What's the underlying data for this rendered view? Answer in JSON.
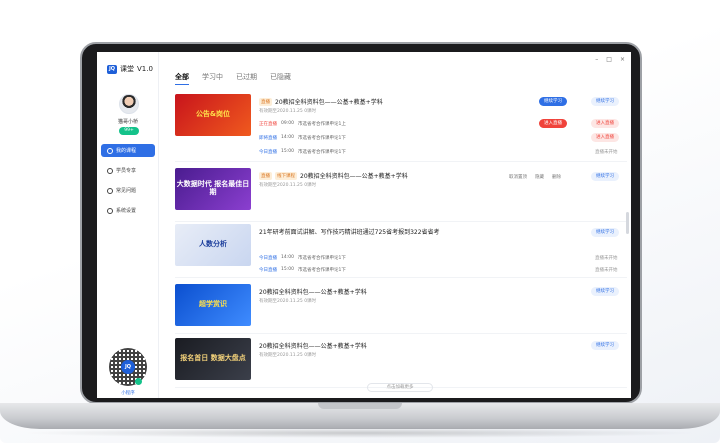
{
  "app": {
    "logo_mark": "JQ",
    "name": "课堂",
    "version": "V1.0"
  },
  "window_controls": {
    "minimize": "–",
    "maximize": "□",
    "close": "×"
  },
  "user": {
    "name": "猫哥小桥",
    "vip": "99+"
  },
  "sidebar": {
    "items": [
      {
        "label": "我的课程",
        "icon": "book-icon",
        "active": true
      },
      {
        "label": "学员专享",
        "icon": "gift-icon",
        "active": false
      },
      {
        "label": "常见问题",
        "icon": "question-icon",
        "active": false
      },
      {
        "label": "系统设置",
        "icon": "gear-icon",
        "active": false
      }
    ],
    "miniapp_label": "小程序"
  },
  "tabs": [
    {
      "label": "全部",
      "active": true
    },
    {
      "label": "学习中",
      "active": false
    },
    {
      "label": "已过期",
      "active": false
    },
    {
      "label": "已隐藏",
      "active": false
    }
  ],
  "courses": [
    {
      "thumb_text": "公告&岗位",
      "tags": [
        "直播"
      ],
      "title": "20教招全科资料包——公基+教基+学科",
      "meta": "有效期至2020.11.25   0课时",
      "primary_btn": "继续学习",
      "secondary_btn": "继续学习",
      "schedule": [
        {
          "status": "正在直播",
          "time": "09:00",
          "desc": "市选省考合作课申论1上",
          "action": "进入直播",
          "note": "进入直播"
        },
        {
          "status": "即将直播",
          "time": "14:00",
          "desc": "市选省考合作课申论1下",
          "action": "",
          "note": "进入直播"
        },
        {
          "status": "今日直播",
          "time": "15:00",
          "desc": "市选省考合作课申论1下",
          "action": "",
          "note": "直播未开始"
        }
      ]
    },
    {
      "thumb_text": "大数据时代 报名最佳日期",
      "tags": [
        "直播",
        "线下课程"
      ],
      "title": "20教招全科资料包——公基+教基+学科",
      "meta": "有效期至2020.11.25   0课时",
      "actions": [
        "取消置顶",
        "隐藏",
        "删除"
      ],
      "secondary_btn": "继续学习"
    },
    {
      "thumb_text": "人数分析",
      "tags": [],
      "title": "21年研考前面试讲解、写作技巧精讲班通过725省考报到322省省考",
      "meta": "",
      "secondary_btn": "继续学习",
      "schedule": [
        {
          "status": "今日直播",
          "time": "14:00",
          "desc": "市选省考合作课申论1下",
          "note": "直播未开始"
        },
        {
          "status": "今日直播",
          "time": "15:00",
          "desc": "市选省考合作课申论1下",
          "note": "直播未开始"
        }
      ]
    },
    {
      "thumb_text": "超学赏识",
      "tags": [],
      "title": "20教招全科资料包——公基+教基+学科",
      "meta": "有效期至2020.11.25   0课时",
      "secondary_btn": "继续学习"
    },
    {
      "thumb_text": "报名首日 数据大盘点",
      "tags": [],
      "title": "20教招全科资料包——公基+教基+学科",
      "meta": "有效期至2020.11.25   0课时",
      "secondary_btn": "继续学习"
    }
  ],
  "load_more": "点击加载更多",
  "colors": {
    "accent": "#2f6fe5",
    "live": "#f0433b",
    "vip": "#14c28a"
  }
}
